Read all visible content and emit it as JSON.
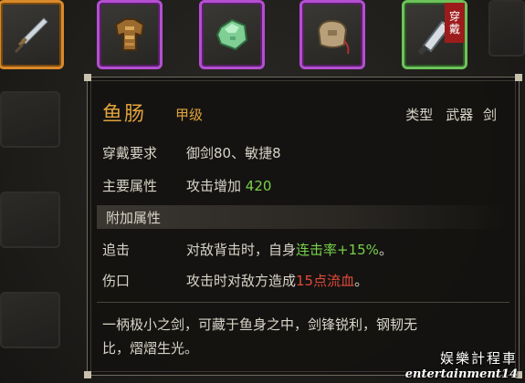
{
  "slots": [
    {
      "icon": "dagger-icon",
      "rarity": "orange"
    },
    {
      "icon": "leather-armor-icon",
      "rarity": "purple"
    },
    {
      "icon": "jade-stone-icon",
      "rarity": "purple"
    },
    {
      "icon": "pouch-icon",
      "rarity": "purple"
    },
    {
      "icon": "cleaver-sword-icon",
      "rarity": "green",
      "badge": "穿戴"
    }
  ],
  "tooltip": {
    "name": "鱼肠",
    "grade": "甲级",
    "type_label": "类型",
    "type_value": "武器 剑",
    "requirement_label": "穿戴要求",
    "requirement_value": "御剑80、敏捷8",
    "main_attr_label": "主要属性",
    "main_attr_text": "攻击增加",
    "main_attr_value": "420",
    "extra_section": "附加属性",
    "effects": [
      {
        "name": "追击",
        "pre": "对敌背击时，自身",
        "highlight": "连击率+15%",
        "post": "。"
      },
      {
        "name": "伤口",
        "pre": "攻击时对敌方造成",
        "highlight": "15点流血",
        "post": "。"
      }
    ],
    "description_line1": "一柄极小之剑，可藏于鱼身之中，剑锋锐利，钢韧无",
    "description_line2": "比，熠熠生光。"
  },
  "watermark": {
    "cn": "娱樂計程車",
    "en": "entertainment14"
  },
  "colors": {
    "orange": "#d88a2a",
    "purple": "#b44fd1",
    "green": "#6cc35a",
    "name": "#e0a23c",
    "positive": "#78d04a",
    "negative": "#e04a3a"
  }
}
